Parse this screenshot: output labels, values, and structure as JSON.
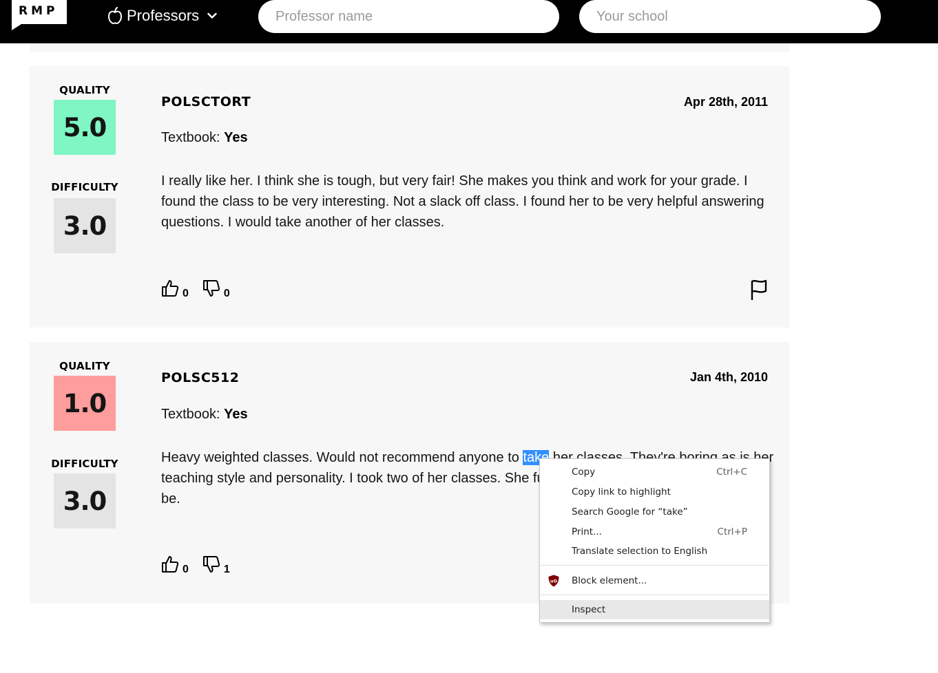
{
  "header": {
    "logo_text": "RMP",
    "professors_label": "Professors",
    "professor_search_placeholder": "Professor name",
    "school_search_placeholder": "Your school"
  },
  "ratings": [
    {
      "quality_label": "QUALITY",
      "quality": "5.0",
      "difficulty_label": "DIFFICULTY",
      "difficulty": "3.0",
      "course": "POLSCTORT",
      "date": "Apr 28th, 2011",
      "textbook_label": "Textbook: ",
      "textbook_value": "Yes",
      "comment": "I really like her. I think she is tough, but very fair! She makes you think and work for your grade. I found the class to be very interesting. Not a slack off class. I found her to be very helpful answering questions. I would take another of her classes.",
      "thumbs_up": "0",
      "thumbs_down": "0"
    },
    {
      "quality_label": "QUALITY",
      "quality": "1.0",
      "difficulty_label": "DIFFICULTY",
      "difficulty": "3.0",
      "course": "POLSC512",
      "date": "Jan 4th, 2010",
      "textbook_label": "Textbook: ",
      "textbook_value": "Yes",
      "comment_before_selection": "Heavy weighted classes. Would not recommend anyone to ",
      "comment_selection": "take",
      "comment_after_selection": " her classes. They're boring as is her teaching style and personality. I took two of her classes. She funding. Snobby too, with no reason to be.",
      "thumbs_up": "0",
      "thumbs_down": "1"
    }
  ],
  "context_menu": {
    "copy": "Copy",
    "copy_shortcut": "Ctrl+C",
    "copy_link": "Copy link to highlight",
    "search_google": "Search Google for “take”",
    "print": "Print...",
    "print_shortcut": "Ctrl+P",
    "translate": "Translate selection to English",
    "block_element": "Block element...",
    "inspect": "Inspect"
  },
  "colors": {
    "quality_high": "#7ff6c3",
    "quality_low": "#ff9c9c",
    "difficulty": "#e4e4e4",
    "selection": "#3390ff"
  }
}
